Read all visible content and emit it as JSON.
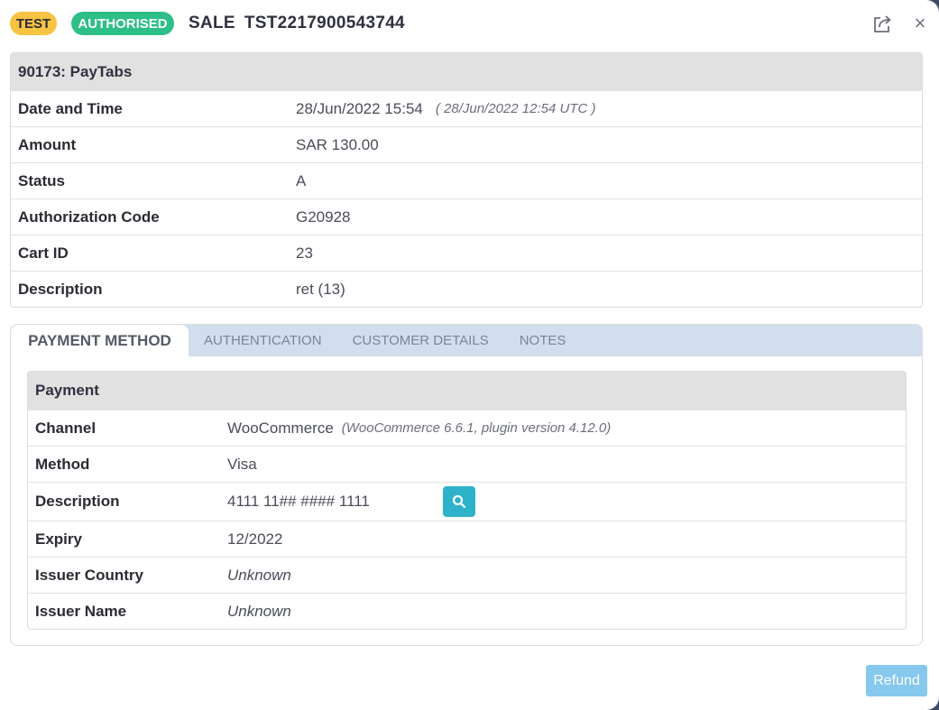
{
  "header": {
    "badge_test": "TEST",
    "badge_status": "AUTHORISED",
    "tran_type": "SALE",
    "tran_ref": "TST2217900543744",
    "share_icon": "share-icon",
    "close_icon": "close-icon",
    "close_glyph": "×"
  },
  "merchant": {
    "title": "90173: PayTabs",
    "rows": [
      {
        "label": "Date and Time",
        "value": "28/Jun/2022 15:54",
        "note": "( 28/Jun/2022 12:54 UTC )"
      },
      {
        "label": "Amount",
        "value": "SAR 130.00"
      },
      {
        "label": "Status",
        "value": "A"
      },
      {
        "label": "Authorization Code",
        "value": "G20928"
      },
      {
        "label": "Cart ID",
        "value": "23"
      },
      {
        "label": "Description",
        "value": "ret (13)"
      }
    ]
  },
  "tabs": [
    {
      "label": "PAYMENT METHOD",
      "active": true
    },
    {
      "label": "AUTHENTICATION"
    },
    {
      "label": "CUSTOMER DETAILS"
    },
    {
      "label": "NOTES"
    }
  ],
  "payment": {
    "title": "Payment",
    "channel": {
      "label": "Channel",
      "value": "WooCommerce",
      "note": "(WooCommerce 6.6.1, plugin version 4.12.0)"
    },
    "method": {
      "label": "Method",
      "value": "Visa"
    },
    "description": {
      "label": "Description",
      "value": "4111 11## #### 1111",
      "icon": "search-icon"
    },
    "expiry": {
      "label": "Expiry",
      "value": "12/2022"
    },
    "issuer_country": {
      "label": "Issuer Country",
      "value": "Unknown"
    },
    "issuer_name": {
      "label": "Issuer Name",
      "value": "Unknown"
    }
  },
  "footer": {
    "refund_label": "Refund"
  },
  "colors": {
    "test_badge": "#f6c343",
    "authorised_badge": "#2dbf87",
    "tab_bar": "#d2deed",
    "search_button": "#2eb2c9",
    "refund_button": "#86c8ee"
  }
}
